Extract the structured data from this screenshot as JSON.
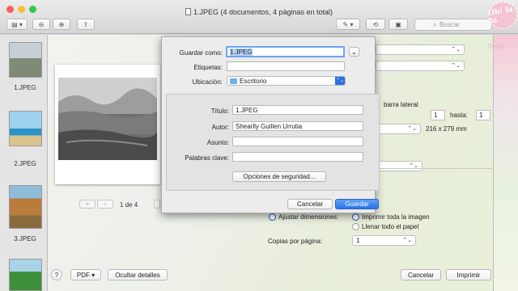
{
  "window": {
    "title": "1.JPEG (4 documentos, 4 páginas en total)",
    "search_placeholder": "Buscar"
  },
  "toolbar": {
    "sidebar_icon": "sidebar-icon",
    "zoom_out_icon": "zoom-out-icon",
    "zoom_in_icon": "zoom-in-icon",
    "share_icon": "share-icon",
    "markup_icon": "markup-icon",
    "rotate_icon": "rotate-icon",
    "toolbox_icon": "toolbox-icon"
  },
  "sidebar": {
    "items": [
      {
        "label": "1.JPEG"
      },
      {
        "label": "2.JPEG"
      },
      {
        "label": "3.JPEG"
      },
      {
        "label": ""
      }
    ]
  },
  "print": {
    "page_indicator": "1 de 4",
    "show_sidebar_label": "barra lateral",
    "range_from": "1",
    "range_to_label": "hasta:",
    "range_to": "1",
    "paper_size": "216 x 279 mm",
    "scale_option_label": "Ajustar dimensiones:",
    "fit_option_1": "Imprimir toda la imagen",
    "fit_option_2": "Llenar todo el papel",
    "copies_per_page_label": "Copias por página:",
    "copies_per_page_value": "1",
    "pdf_label": "PDF",
    "hide_details_label": "Ocultar detalles",
    "help_label": "?",
    "cancel_label": "Cancelar",
    "print_label": "Imprimir"
  },
  "save_dialog": {
    "save_as_label": "Guardar como:",
    "save_as_value": "1.JPEG",
    "tags_label": "Etiquetas:",
    "tags_value": "",
    "location_label": "Ubicación:",
    "location_value": "Escritorio",
    "title_label": "Título:",
    "title_value": "1.JPEG",
    "author_label": "Autor:",
    "author_value": "Shearlly Guillen Urrutia",
    "subject_label": "Asunto:",
    "subject_value": "",
    "keywords_label": "Palabras clave:",
    "keywords_value": "",
    "security_button": "Opciones de seguridad...",
    "cancel_button": "Cancelar",
    "save_button": "Guardar"
  },
  "branding": {
    "logo_text": "Oh! la la",
    "watermark": "Dvelly"
  },
  "colors": {
    "accent": "#2d6fe0",
    "primary_button": "#2a74e6",
    "logo_pink": "#f4c4d2"
  }
}
